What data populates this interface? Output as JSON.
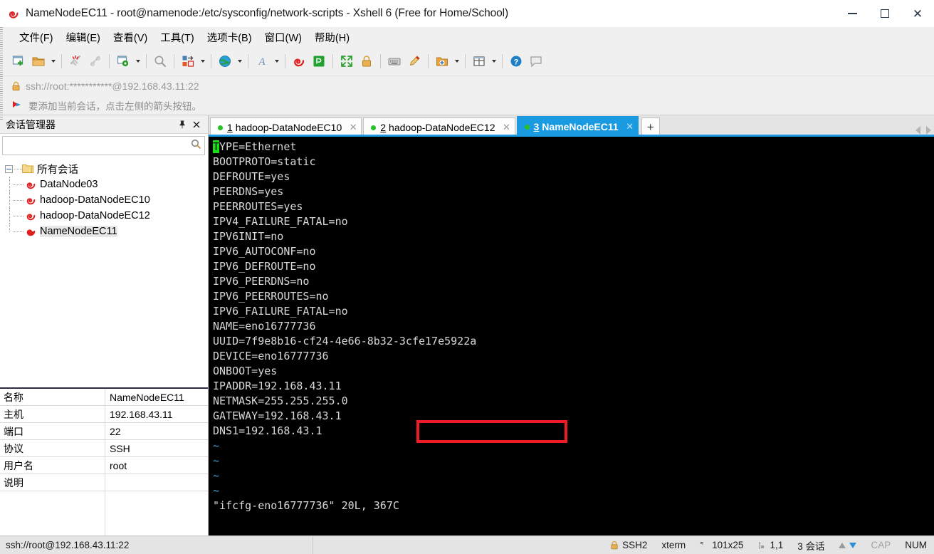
{
  "window": {
    "title": "NameNodeEC11 - root@namenode:/etc/sysconfig/network-scripts - Xshell 6 (Free for Home/School)",
    "app_icon": "xshell-icon",
    "minimize_label": "—",
    "maximize_label": "",
    "close_label": "✕"
  },
  "menu": {
    "items": [
      {
        "label": "文件(F)",
        "name": "menu-file"
      },
      {
        "label": "编辑(E)",
        "name": "menu-edit"
      },
      {
        "label": "查看(V)",
        "name": "menu-view"
      },
      {
        "label": "工具(T)",
        "name": "menu-tools"
      },
      {
        "label": "选项卡(B)",
        "name": "menu-tabs"
      },
      {
        "label": "窗口(W)",
        "name": "menu-window"
      },
      {
        "label": "帮助(H)",
        "name": "menu-help"
      }
    ]
  },
  "toolbar": {
    "icons": [
      "new-session-icon",
      "open-folder-icon",
      "disconnect-icon",
      "reconnect-icon",
      "session-properties-icon",
      "find-icon",
      "transfer-file-icon",
      "globe-icon",
      "font-icon",
      "xshell-icon",
      "xftp-icon",
      "fullscreen-icon",
      "lock-icon",
      "keyboard-icon",
      "highlight-icon",
      "add-folder-icon",
      "layout-icon",
      "help-icon",
      "comment-icon"
    ]
  },
  "address_bar": {
    "lock_icon": "lock-icon",
    "url": "ssh://root:***********@192.168.43.11:22"
  },
  "notice_bar": {
    "icon": "arrow-flag-icon",
    "text": "要添加当前会话，点击左侧的箭头按钮。"
  },
  "session_panel": {
    "title": "会话管理器",
    "pin_icon": "pin-icon",
    "close_icon": "close-icon",
    "search": {
      "value": "",
      "placeholder": "",
      "icon": "search-icon"
    },
    "tree": {
      "root": {
        "label": "所有会话",
        "icon": "folder-icon",
        "expanded": true
      },
      "children": [
        {
          "label": "DataNode03",
          "icon": "session-icon",
          "selected": false
        },
        {
          "label": "hadoop-DataNodeEC10",
          "icon": "session-icon",
          "selected": false
        },
        {
          "label": "hadoop-DataNodeEC12",
          "icon": "session-icon",
          "selected": false
        },
        {
          "label": "NameNodeEC11",
          "icon": "session-icon",
          "selected": true
        }
      ]
    }
  },
  "properties": {
    "rows": [
      {
        "key": "名称",
        "value": "NameNodeEC11"
      },
      {
        "key": "主机",
        "value": "192.168.43.11"
      },
      {
        "key": "端口",
        "value": "22"
      },
      {
        "key": "协议",
        "value": "SSH"
      },
      {
        "key": "用户名",
        "value": "root"
      },
      {
        "key": "说明",
        "value": ""
      }
    ]
  },
  "tabs": {
    "items": [
      {
        "num": "1",
        "label": "hadoop-DataNodeEC10",
        "active": false,
        "status": "connected",
        "close_label": "✕"
      },
      {
        "num": "2",
        "label": "hadoop-DataNodeEC12",
        "active": false,
        "status": "connected",
        "close_label": "✕"
      },
      {
        "num": "3",
        "label": "NameNodeEC11",
        "active": true,
        "status": "connected",
        "close_label": "✕"
      }
    ],
    "add_label": "+",
    "scroll_left_icon": "chevron-left-icon",
    "scroll_right_icon": "chevron-right-icon"
  },
  "terminal": {
    "cursor_char": "T",
    "first_line_rest": "YPE=Ethernet",
    "lines": [
      "BOOTPROTO=static",
      "DEFROUTE=yes",
      "PEERDNS=yes",
      "PEERROUTES=yes",
      "IPV4_FAILURE_FATAL=no",
      "IPV6INIT=no",
      "IPV6_AUTOCONF=no",
      "IPV6_DEFROUTE=no",
      "IPV6_PEERDNS=no",
      "IPV6_PEERROUTES=no",
      "IPV6_FAILURE_FATAL=no",
      "NAME=eno16777736",
      "UUID=7f9e8b16-cf24-4e66-8b32-3cfe17e5922a",
      "DEVICE=eno16777736",
      "ONBOOT=yes",
      "IPADDR=192.168.43.11",
      "NETMASK=255.255.255.0",
      "GATEWAY=192.168.43.1",
      "DNS1=192.168.43.1"
    ],
    "tildes": [
      "~",
      "~",
      "~",
      "~"
    ],
    "status_line": "\"ifcfg-eno16777736\" 20L, 367C",
    "annotation": {
      "shape": "rectangle",
      "color": "#ee1c25",
      "target": "DNS1=192.168.43.1"
    }
  },
  "status_bar": {
    "connection": "ssh://root@192.168.43.11:22",
    "protocol": "SSH2",
    "protocol_icon": "lock-icon",
    "term_type": "xterm",
    "size": "101x25",
    "size_icon": "resize-icon",
    "cursor_pos": "1,1",
    "cursor_icon": "cursor-icon",
    "sessions": "3 会话",
    "upload_icon": "arrow-up-icon",
    "download_icon": "arrow-down-icon",
    "cap": "CAP",
    "num": "NUM"
  },
  "colors": {
    "accent": "#1a9ae1",
    "annotation": "#ee1c25",
    "terminal_bg": "#000000",
    "terminal_fg": "#d8d8d8",
    "cursor": "#16e016",
    "tilde": "#4a9fd4",
    "tab_dot": "#27c127"
  }
}
